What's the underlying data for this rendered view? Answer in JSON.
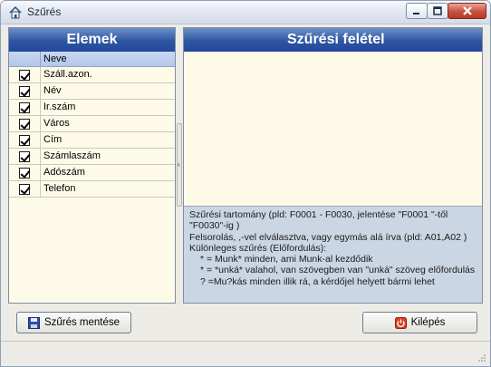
{
  "window": {
    "title": "Szűrés",
    "buttons": {
      "minimize": "–",
      "maximize": "□",
      "close": "×"
    }
  },
  "left_panel": {
    "header": "Elemek",
    "column": "Neve",
    "rows": [
      {
        "label": "Száll.azon.",
        "checked": true
      },
      {
        "label": "Név",
        "checked": true
      },
      {
        "label": "Ir.szám",
        "checked": true
      },
      {
        "label": "Város",
        "checked": true
      },
      {
        "label": "Cím",
        "checked": true
      },
      {
        "label": "Számlaszám",
        "checked": true
      },
      {
        "label": "Adószám",
        "checked": true
      },
      {
        "label": "Telefon",
        "checked": true
      }
    ]
  },
  "splitter": {
    "arrow": "‹"
  },
  "right_panel": {
    "header": "Szűrési felétel",
    "input_value": "",
    "help": [
      "Szűrési tartomány (pld: F0001 - F0030, jelentése \"F0001  \"-től",
      "\"F0030\"-ig )",
      "Felsorolás, ,-vel elválasztva,  vagy egymás alá írva (pld: A01,A02 )",
      "Különleges szűrés (Előfordulás):",
      "* = Munk* minden, ami Munk-al kezdődik",
      "* = *unká* valahol, van szövegben van \"unká\" szöveg előfordulás",
      "? =Mu?kás minden illik rá, a kérdőjel helyett bármi lehet"
    ]
  },
  "buttons": {
    "save": "Szűrés mentése",
    "exit": "Kilépés"
  },
  "colors": {
    "header_blue": "#2d56a3",
    "panel_bg": "#fdfbe8",
    "help_bg": "#cad6e4",
    "exit_icon": "#d9401f"
  }
}
